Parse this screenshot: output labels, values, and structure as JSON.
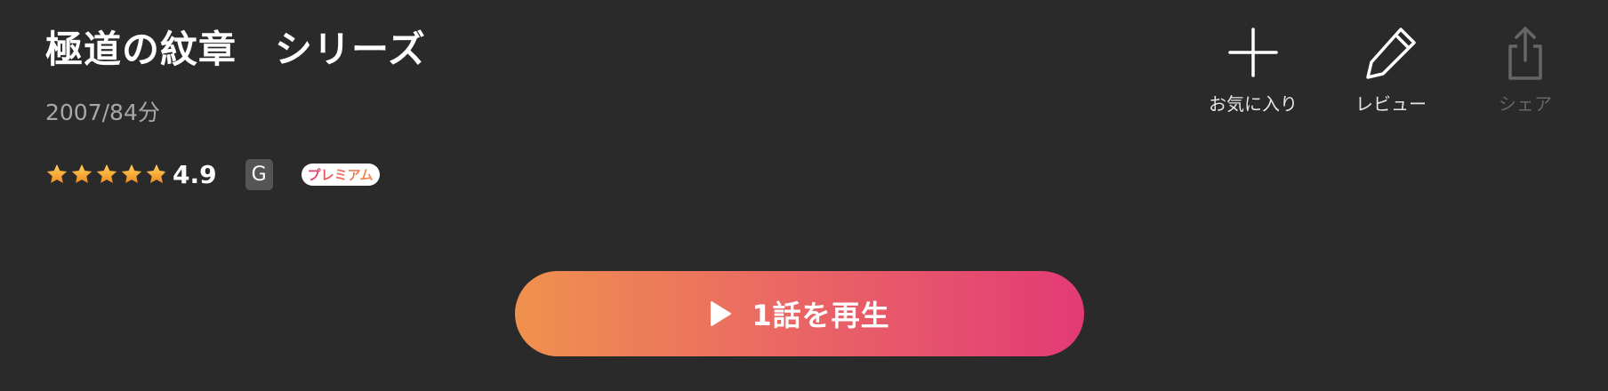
{
  "title": "極道の紋章　シリーズ",
  "meta": "2007/84分",
  "rating": {
    "value": "4.9",
    "stars": 4.9,
    "star_color": "#f5a623"
  },
  "badges": {
    "age": "G",
    "premium": "プレミアム"
  },
  "actions": [
    {
      "label": "お気に入り",
      "icon": "plus-icon",
      "enabled": true
    },
    {
      "label": "レビュー",
      "icon": "pencil-icon",
      "enabled": true
    },
    {
      "label": "シェア",
      "icon": "share-icon",
      "enabled": false
    }
  ],
  "play": {
    "label": "1話を再生",
    "icon": "play-icon",
    "gradient": [
      "#f0914e",
      "#e33a76"
    ]
  },
  "colors": {
    "background": "#2a2a2a",
    "text": "#ffffff",
    "muted": "#a8a8a8",
    "disabled": "#666666"
  }
}
